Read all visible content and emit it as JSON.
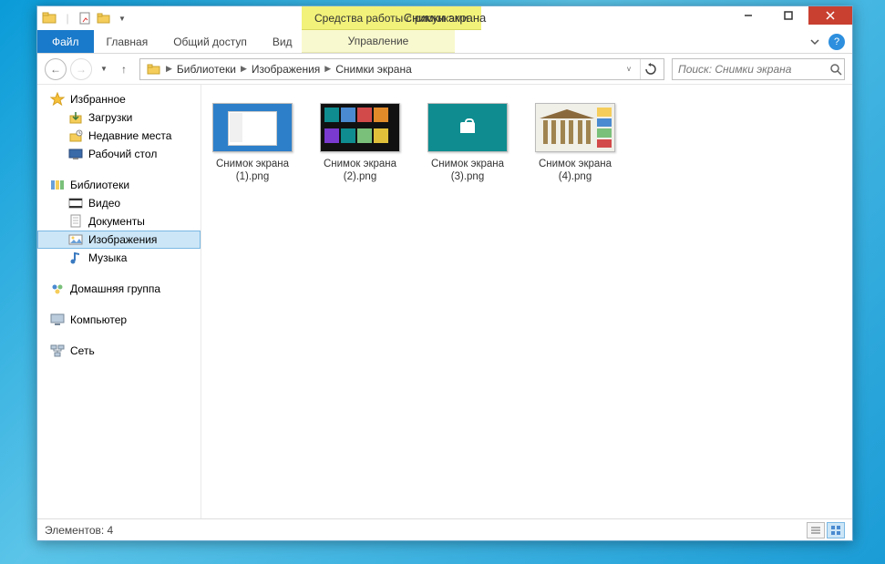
{
  "window": {
    "title": "Снимки экрана",
    "context_tab": "Средства работы с рисунками"
  },
  "ribbon": {
    "file": "Файл",
    "home": "Главная",
    "share": "Общий доступ",
    "view": "Вид",
    "manage": "Управление"
  },
  "breadcrumb": {
    "seg1": "Библиотеки",
    "seg2": "Изображения",
    "seg3": "Снимки экрана"
  },
  "search": {
    "placeholder": "Поиск: Снимки экрана"
  },
  "nav": {
    "favorites": "Избранное",
    "downloads": "Загрузки",
    "recent": "Недавние места",
    "desktop": "Рабочий стол",
    "libraries": "Библиотеки",
    "video": "Видео",
    "documents": "Документы",
    "pictures": "Изображения",
    "music": "Музыка",
    "homegroup": "Домашняя группа",
    "computer": "Компьютер",
    "network": "Сеть"
  },
  "files": [
    {
      "name": "Снимок экрана (1).png"
    },
    {
      "name": "Снимок экрана (2).png"
    },
    {
      "name": "Снимок экрана (3).png"
    },
    {
      "name": "Снимок экрана (4).png"
    }
  ],
  "status": {
    "count": "Элементов: 4"
  }
}
